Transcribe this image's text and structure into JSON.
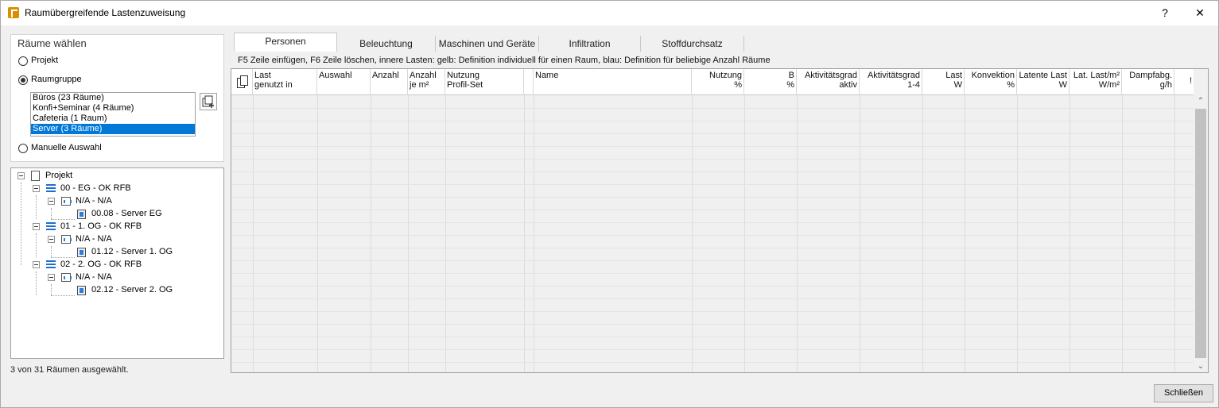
{
  "window": {
    "title": "Raumübergreifende Lastenzuweisung",
    "help": "?",
    "close": "✕"
  },
  "rooms": {
    "group_title": "Räume wählen",
    "opt_project": "Projekt",
    "opt_group": "Raumgruppe",
    "opt_manual": "Manuelle Auswahl",
    "groups": [
      "Büros (23 Räume)",
      "Konfi+Seminar (4 Räume)",
      "Cafeteria (1 Raum)",
      "Server (3 Räume)"
    ],
    "selected_group": "Server (3 Räume)"
  },
  "tree": {
    "root": "Projekt",
    "levels": [
      {
        "name": "00 - EG - OK RFB",
        "zone": "N/A - N/A",
        "room": "00.08 - Server EG"
      },
      {
        "name": "01 - 1. OG - OK RFB",
        "zone": "N/A - N/A",
        "room": "01.12 - Server 1. OG"
      },
      {
        "name": "02 - 2. OG - OK RFB",
        "zone": "N/A - N/A",
        "room": "02.12 - Server 2. OG"
      }
    ]
  },
  "status": "3 von 31 Räumen ausgewählt.",
  "tabs": [
    "Personen",
    "Beleuchtung",
    "Maschinen und Geräte",
    "Infiltration",
    "Stoffdurchsatz"
  ],
  "hint": "F5 Zeile einfügen, F6 Zeile löschen, innere Lasten: gelb: Definition individuell für einen Raum, blau: Definition für beliebige Anzahl Räume",
  "columns": [
    {
      "l1": "Last",
      "l2": "genutzt in"
    },
    {
      "l1": "",
      "l2": "Auswahl"
    },
    {
      "l1": "",
      "l2": "Anzahl"
    },
    {
      "l1": "Anzahl",
      "l2": "je m²"
    },
    {
      "l1": "Nutzung",
      "l2": "Profil-Set"
    },
    {
      "l1": "",
      "l2": ""
    },
    {
      "l1": "",
      "l2": "Name"
    },
    {
      "l1": "Nutzung",
      "l2": "%"
    },
    {
      "l1": "B",
      "l2": "%"
    },
    {
      "l1": "Aktivitätsgrad",
      "l2": "aktiv"
    },
    {
      "l1": "Aktivitätsgrad",
      "l2": "1-4"
    },
    {
      "l1": "Last",
      "l2": "W"
    },
    {
      "l1": "Konvektion",
      "l2": "%"
    },
    {
      "l1": "Latente Last",
      "l2": "W"
    },
    {
      "l1": "Lat. Last/m²",
      "l2": "W/m²"
    },
    {
      "l1": "Dampfabg.",
      "l2": "g/h"
    },
    {
      "l1": "!",
      "l2": ""
    }
  ],
  "close_button": "Schließen"
}
